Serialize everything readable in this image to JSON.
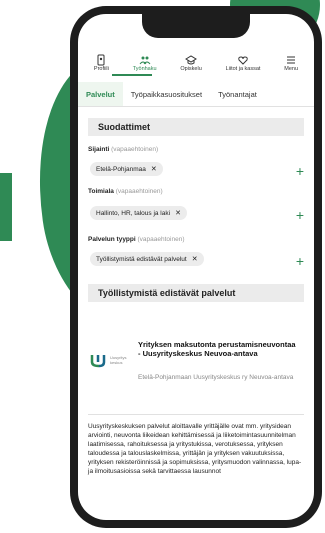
{
  "nav": [
    {
      "label": "Profiili",
      "icon": "profile-icon"
    },
    {
      "label": "Työnhaku",
      "icon": "people-icon",
      "active": true
    },
    {
      "label": "Opiskelu",
      "icon": "graduation-icon"
    },
    {
      "label": "Liitot ja kassat",
      "icon": "heart-icon"
    },
    {
      "label": "Menu",
      "icon": "menu-icon"
    }
  ],
  "tabs": [
    "Palvelut",
    "Työpaikkasuositukset",
    "Työnantajat"
  ],
  "filters": {
    "title": "Suodattimet",
    "optional": "(vapaaehtoinen)",
    "sijainti": {
      "label": "Sijainti",
      "chip": "Etelä-Pohjanmaa"
    },
    "toimiala": {
      "label": "Toimiala",
      "chip": "Hallinto, HR, talous ja laki"
    },
    "tyyppi": {
      "label": "Palvelun tyyppi",
      "chip": "Työllistymistä edistävät palvelut"
    }
  },
  "results": {
    "title": "Työllistymistä edistävät palvelut",
    "card_title": "Yrityksen maksutonta perustamisneuvontaa - Uusyrityskeskus Neuvoa-antava",
    "card_sub": "Etelä-Pohjanmaan Uusyrityskeskus ry Neuvoa-antava",
    "body": "Uusyrityskeskuksen palvelut aloittavalle yrittäjälle ovat mm. yritysidean arviointi, neuvonta liikeidean kehittämisessä ja liiketoimintasuunnitelman laatimisessa, rahoituksessa ja yritystukissa, verotuksessa, yrityksen taloudessa ja talouslaskelmissa, yrittäjän ja yrityksen vakuutuksissa, yrityksen rekisteröinnissä ja sopimuksissa, yritysmuodon valinnassa, lupa- ja ilmoitusasioissa sekä tarvittaessa lausunnot"
  },
  "colors": {
    "accent": "#2f8a55"
  }
}
